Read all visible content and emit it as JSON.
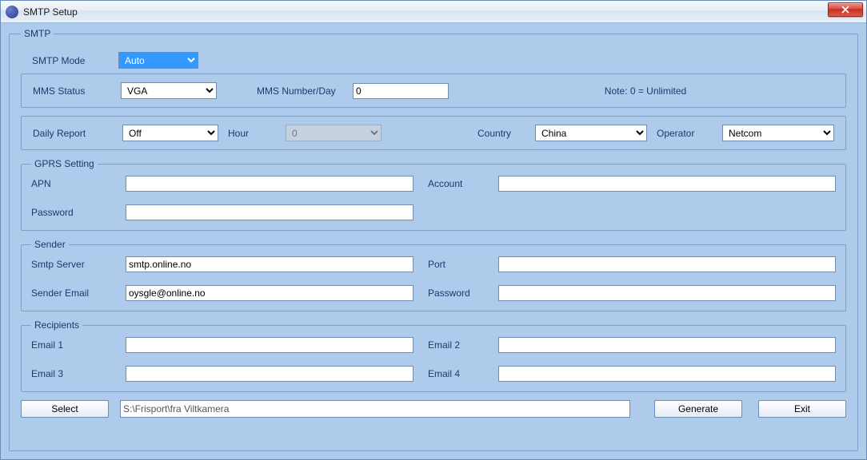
{
  "window": {
    "title": "SMTP Setup"
  },
  "outer": {
    "legend": "SMTP"
  },
  "smtp_mode": {
    "label": "SMTP Mode",
    "value": "Auto"
  },
  "mms_row": {
    "status_label": "MMS Status",
    "status_value": "VGA",
    "numday_label": "MMS Number/Day",
    "numday_value": "0",
    "note": "Note: 0 = Unlimited"
  },
  "daily_row": {
    "report_label": "Daily Report",
    "report_value": "Off",
    "hour_label": "Hour",
    "hour_value": "0",
    "country_label": "Country",
    "country_value": "China",
    "operator_label": "Operator",
    "operator_value": "Netcom"
  },
  "gprs": {
    "legend": "GPRS Setting",
    "apn_label": "APN",
    "apn_value": "",
    "password_label": "Password",
    "password_value": "",
    "account_label": "Account",
    "account_value": ""
  },
  "sender": {
    "legend": "Sender",
    "server_label": "Smtp Server",
    "server_value": "smtp.online.no",
    "port_label": "Port",
    "port_value": "",
    "email_label": "Sender Email",
    "email_value": "oysgle@online.no",
    "password_label": "Password",
    "password_value": ""
  },
  "recipients": {
    "legend": "Recipients",
    "email1_label": "Email 1",
    "email1_value": "",
    "email2_label": "Email 2",
    "email2_value": "",
    "email3_label": "Email 3",
    "email3_value": "",
    "email4_label": "Email 4",
    "email4_value": ""
  },
  "bottom": {
    "select_label": "Select",
    "path_value": "S:\\Frisport\\fra Viltkamera",
    "generate_label": "Generate",
    "exit_label": "Exit"
  }
}
